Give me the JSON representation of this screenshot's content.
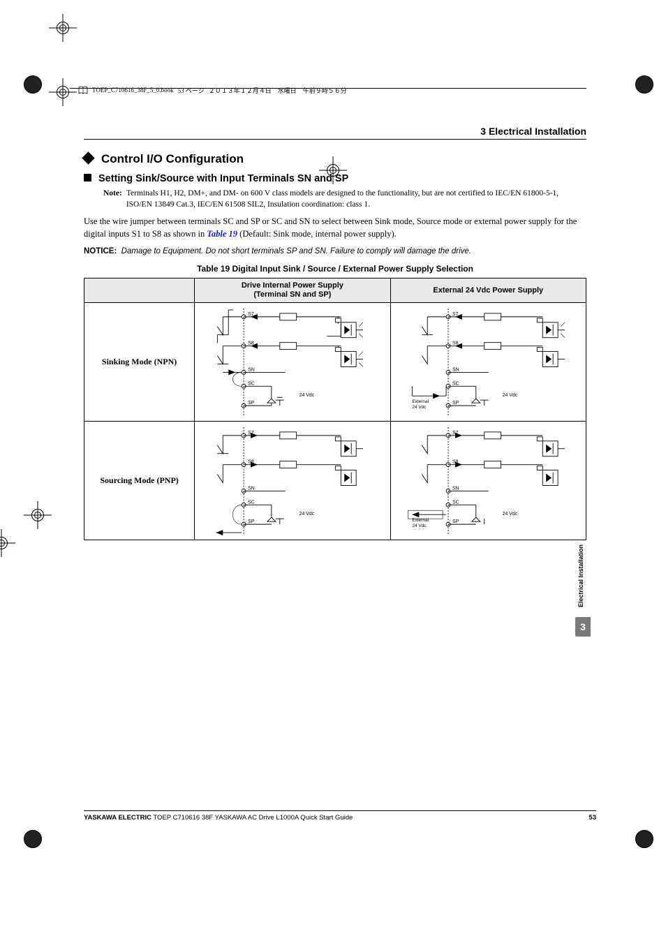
{
  "proofHeader": {
    "file": "TOEP_C710616_38F_5_0.book",
    "page": "53 ページ",
    "date": "２０１３年１２月４日　水曜日　午前９時５６分"
  },
  "runningHead": "3  Electrical Installation",
  "section": {
    "title": "Control I/O Configuration"
  },
  "subsection": {
    "title": "Setting Sink/Source with Input Terminals SN and SP"
  },
  "note": {
    "lead": "Note:",
    "text": "Terminals H1, H2, DM+, and DM- on 600 V class models are designed to the functionality, but are not certified to IEC/EN 61800-5-1, ISO/EN 13849 Cat.3, IEC/EN 61508 SIL2, Insulation coordination: class 1."
  },
  "paragraph": {
    "p1a": "Use the wire jumper between terminals SC and SP or SC and SN to select between Sink mode, Source mode or external power supply for the digital inputs S1 to S8 as shown in ",
    "link": "Table 19",
    "p1b": " (Default: Sink mode, internal power supply)."
  },
  "notice": {
    "lead": "NOTICE:",
    "msg": "Damage to Equipment. Do not short terminals SP and SN. Failure to comply will damage the drive."
  },
  "table": {
    "caption": "Table 19  Digital Input Sink / Source / External Power Supply Selection",
    "cornerBlank": "",
    "col1Header": "Drive Internal Power Supply\n(Terminal SN and SP)",
    "col2Header": "External 24 Vdc Power Supply",
    "row1Label": "Sinking Mode (NPN)",
    "row2Label": "Sourcing Mode (PNP)"
  },
  "diagLabels": {
    "s7": "S7",
    "s8": "S8",
    "sn": "SN",
    "sc": "SC",
    "sp": "SP",
    "v24": "24 Vdc",
    "ext1": "External",
    "ext2": "24 Vdc"
  },
  "sideTab": {
    "label": "Electrical Installation",
    "num": "3"
  },
  "footer": {
    "brand": "YASKAWA ELECTRIC",
    "doc": " TOEP C710616 38F YASKAWA AC Drive L1000A Quick Start Guide",
    "page": "53"
  }
}
